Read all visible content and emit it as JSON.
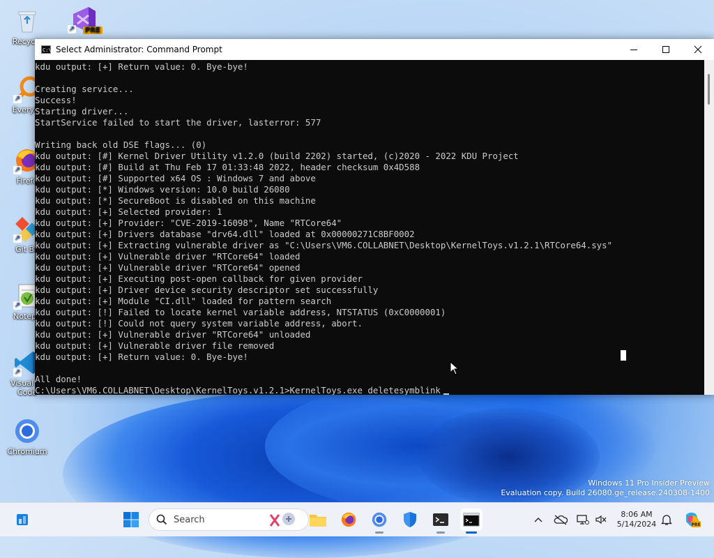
{
  "desktop": {
    "icons": [
      {
        "label": "Recycle Bin",
        "short": "Recycle",
        "name": "recycle-bin"
      },
      {
        "label": "PRE",
        "short": "",
        "name": "visual-studio-preview"
      },
      {
        "label": "Everything",
        "short": "Everyth",
        "name": "everything"
      },
      {
        "label": "Firefox",
        "short": "Firefo",
        "name": "firefox"
      },
      {
        "label": "Git Bash",
        "short": "Git Ba",
        "name": "git-bash"
      },
      {
        "label": "Notepad++",
        "short": "Notepa",
        "name": "notepadpp"
      },
      {
        "label": "Visual Studio Code",
        "short": "Visual St Code",
        "name": "vscode"
      },
      {
        "label": "Chromium",
        "short": "Chromium",
        "name": "chromium"
      }
    ],
    "badge_pre": "PRE"
  },
  "window": {
    "title": "Select Administrator: Command Prompt",
    "icon_text": "C:\\"
  },
  "console": {
    "lines": [
      "kdu output: [+] Return value: 0. Bye-bye!",
      "",
      "Creating service...",
      "Success!",
      "Starting driver...",
      "StartService failed to start the driver, lasterror: 577",
      "",
      "Writing back old DSE flags... (0)",
      "kdu output: [#] Kernel Driver Utility v1.2.0 (build 2202) started, (c)2020 - 2022 KDU Project",
      "kdu output: [#] Build at Thu Feb 17 01:33:48 2022, header checksum 0x4D588",
      "kdu output: [#] Supported x64 OS : Windows 7 and above",
      "kdu output: [*] Windows version: 10.0 build 26080",
      "kdu output: [*] SecureBoot is disabled on this machine",
      "kdu output: [+] Selected provider: 1",
      "kdu output: [+] Provider: \"CVE-2019-16098\", Name \"RTCore64\"",
      "kdu output: [+] Drivers database \"drv64.dll\" loaded at 0x00000271C8BF0002",
      "kdu output: [+] Extracting vulnerable driver as \"C:\\Users\\VM6.COLLABNET\\Desktop\\KernelToys.v1.2.1\\RTCore64.sys\"",
      "kdu output: [+] Vulnerable driver \"RTCore64\" loaded",
      "kdu output: [+] Vulnerable driver \"RTCore64\" opened",
      "kdu output: [+] Executing post-open callback for given provider",
      "kdu output: [+] Driver device security descriptor set successfully",
      "kdu output: [+] Module \"CI.dll\" loaded for pattern search",
      "kdu output: [!] Failed to locate kernel variable address, NTSTATUS (0xC0000001)",
      "kdu output: [!] Could not query system variable address, abort.",
      "kdu output: [+] Vulnerable driver \"RTCore64\" unloaded",
      "kdu output: [+] Vulnerable driver file removed",
      "kdu output: [+] Return value: 0. Bye-bye!",
      "",
      "All done!"
    ],
    "prompt": "C:\\Users\\VM6.COLLABNET\\Desktop\\KernelToys.v1.2.1>",
    "command": "KernelToys.exe deletesymblink"
  },
  "watermark": {
    "line1": "Windows 11 Pro Insider Preview",
    "line2": "Evaluation copy. Build 26080.ge_release.240308-1400"
  },
  "taskbar": {
    "search_label": "Search",
    "time": "8:06 AM",
    "date": "5/14/2024",
    "pinned": [
      "widgets",
      "start",
      "search",
      "copilot-search-highlight",
      "file-explorer",
      "firefox",
      "chromium",
      "defender",
      "terminal",
      "command-prompt"
    ]
  },
  "colors": {
    "console_bg": "#0c0c0c",
    "console_fg": "#cccccc",
    "accent": "#0a5fd0"
  }
}
